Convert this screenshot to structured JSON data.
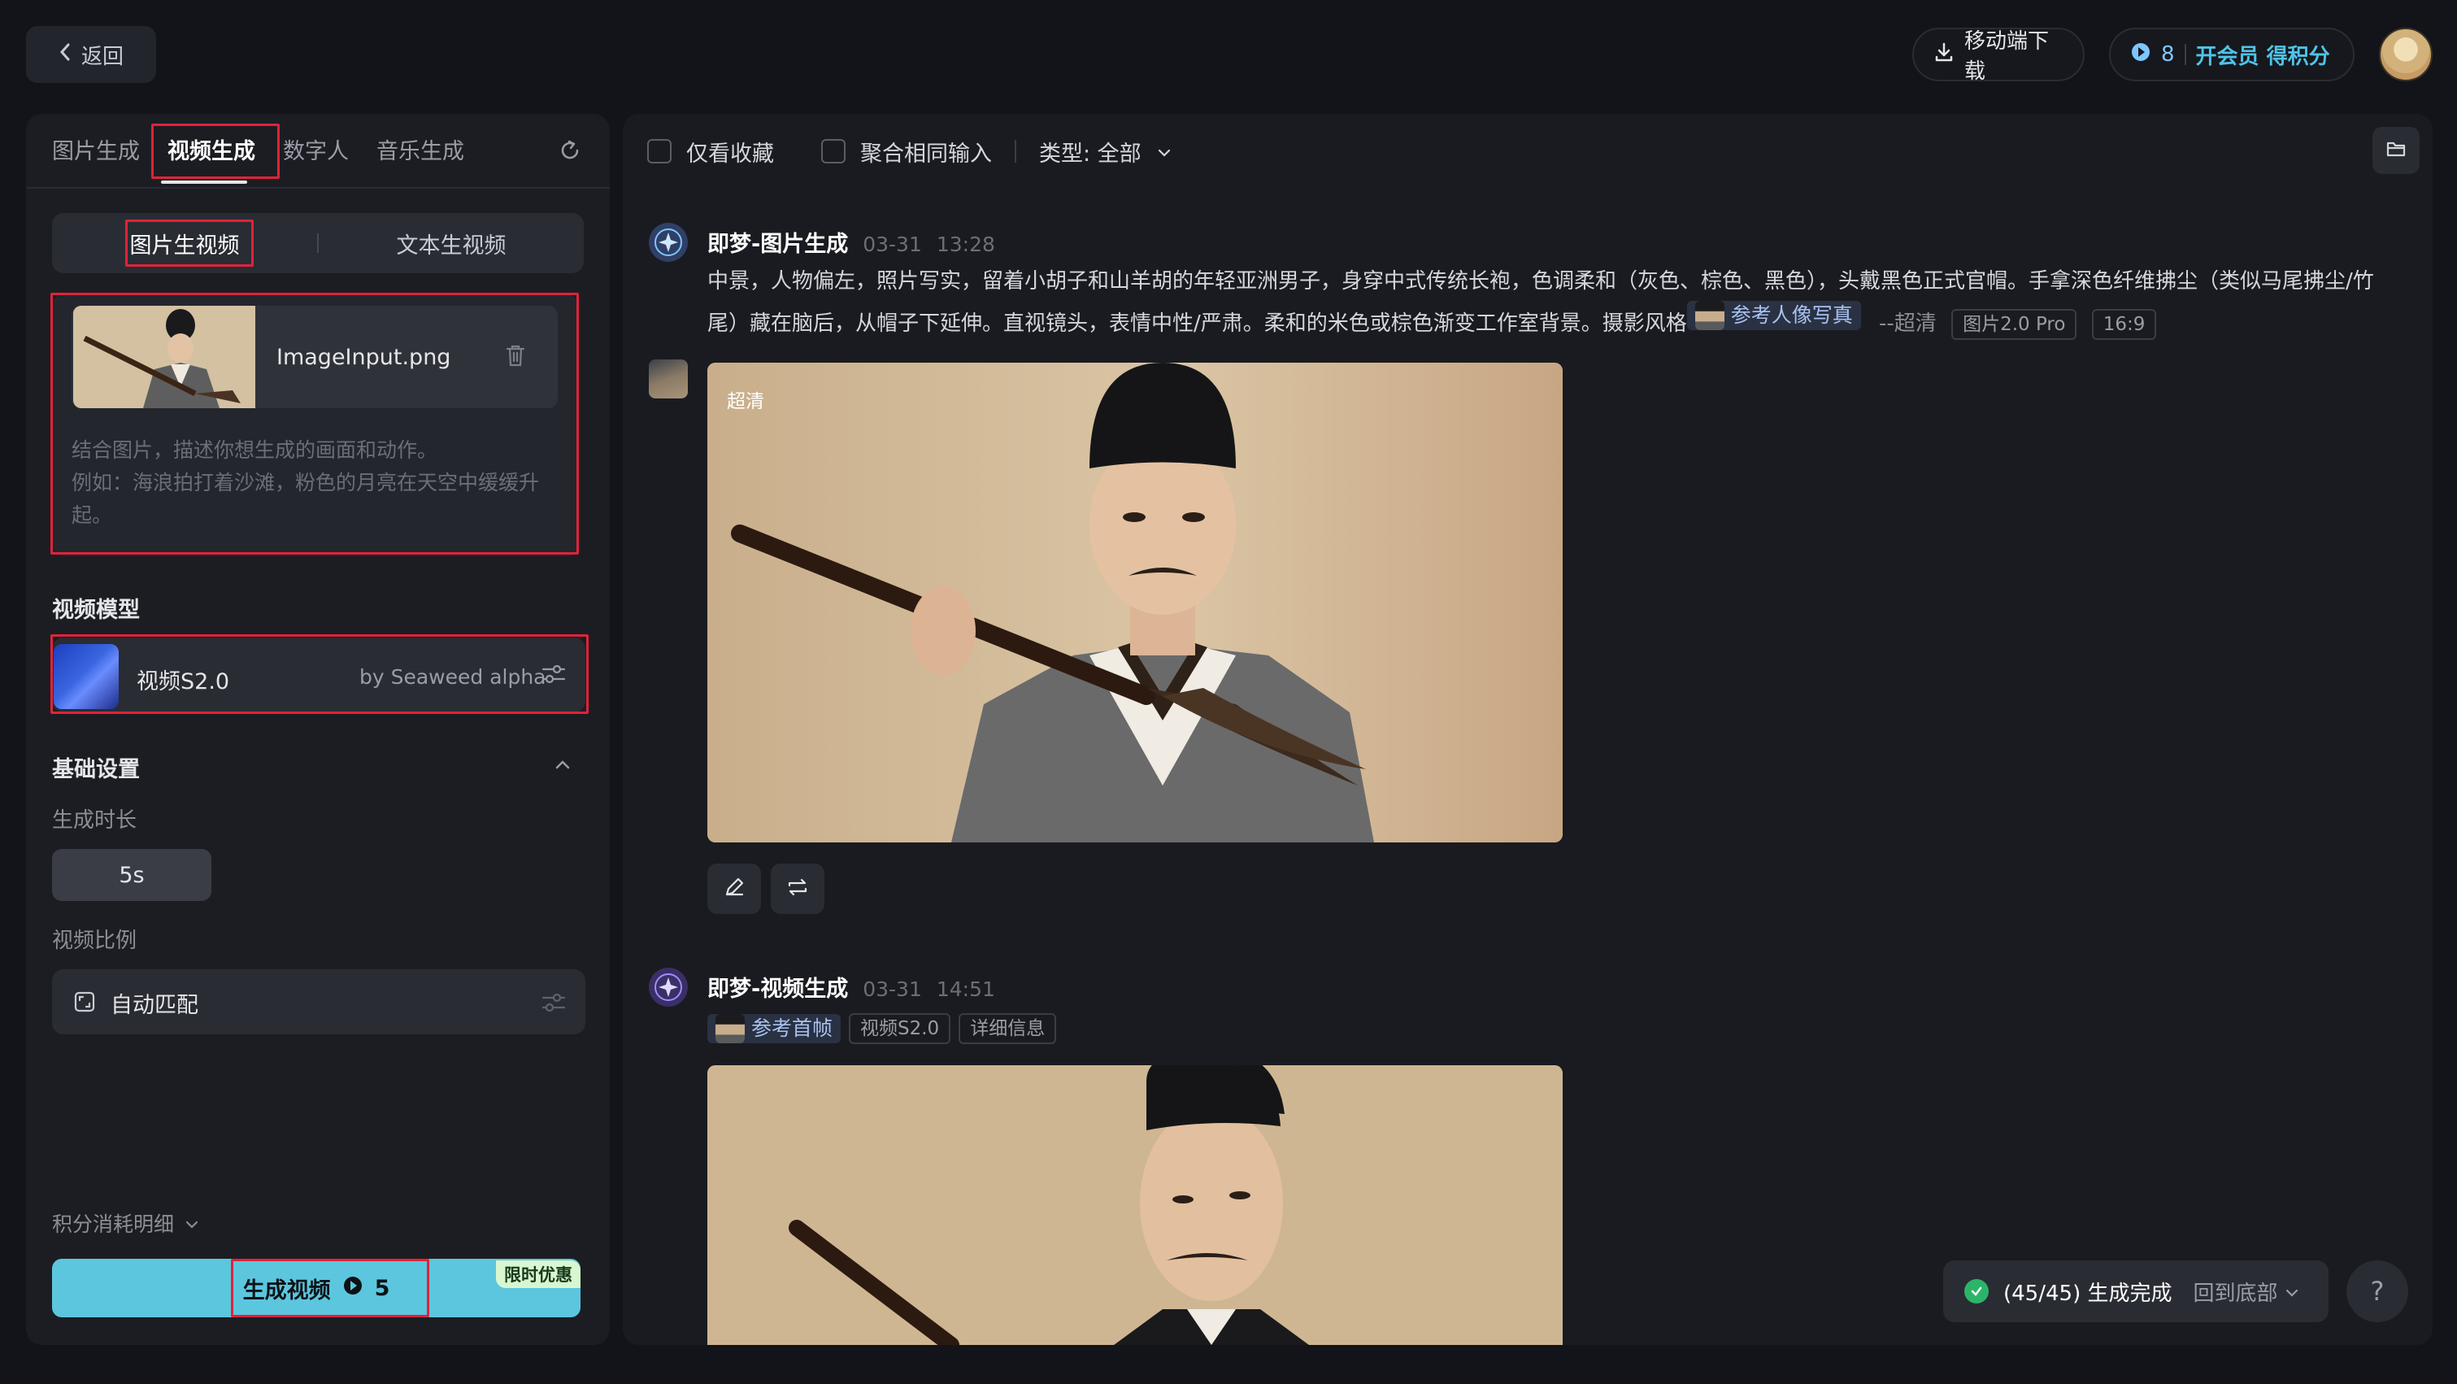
{
  "topbar": {
    "back_label": "返回",
    "download_label": "移动端下载",
    "points": "8",
    "vip_label": "开会员 得积分"
  },
  "left": {
    "tabs": [
      "图片生成",
      "视频生成",
      "数字人",
      "音乐生成"
    ],
    "active_tab_index": 1,
    "modes": [
      "图片生视频",
      "文本生视频"
    ],
    "upload": {
      "file_name": "ImageInput.png",
      "hint_line1": "结合图片，描述你想生成的画面和动作。",
      "hint_line2": "例如：海浪拍打着沙滩，粉色的月亮在天空中缓缓升起。"
    },
    "model_section_label": "视频模型",
    "model": {
      "name": "视频S2.0",
      "by": "by Seaweed alpha"
    },
    "basic_section_label": "基础设置",
    "duration_label": "生成时长",
    "duration_value": "5s",
    "ratio_label": "视频比例",
    "ratio_value": "自动匹配",
    "points_detail_label": "积分消耗明细",
    "generate_label": "生成视频",
    "generate_cost": "5",
    "promo_label": "限时优惠"
  },
  "right": {
    "filters": {
      "fav_only": "仅看收藏",
      "merge_same": "聚合相同输入",
      "type_label": "类型: 全部"
    },
    "messages": [
      {
        "title": "即梦-图片生成",
        "date": "03-31",
        "time": "13:28",
        "prompt": "中景，人物偏左，照片写实，留着小胡子和山羊胡的年轻亚洲男子，身穿中式传统长袍，色调柔和（灰色、棕色、黑色），头戴黑色正式官帽。手拿深色纤维拂尘（类似马尾拂尘/竹尾）藏在脑后，从帽子下延伸。直视镜头，表情中性/严肃。柔和的米色或棕色渐变工作室背景。摄影风格",
        "ref_chip": "参考人像写真",
        "quality": "--超清",
        "tags": [
          "图片2.0 Pro",
          "16:9"
        ],
        "image_badge": "超清"
      },
      {
        "title": "即梦-视频生成",
        "date": "03-31",
        "time": "14:51",
        "ref_chip": "参考首帧",
        "tags": [
          "视频S2.0",
          "详细信息"
        ]
      }
    ],
    "toast": {
      "status": "(45/45) 生成完成",
      "link": "回到底部"
    },
    "help": "?"
  }
}
